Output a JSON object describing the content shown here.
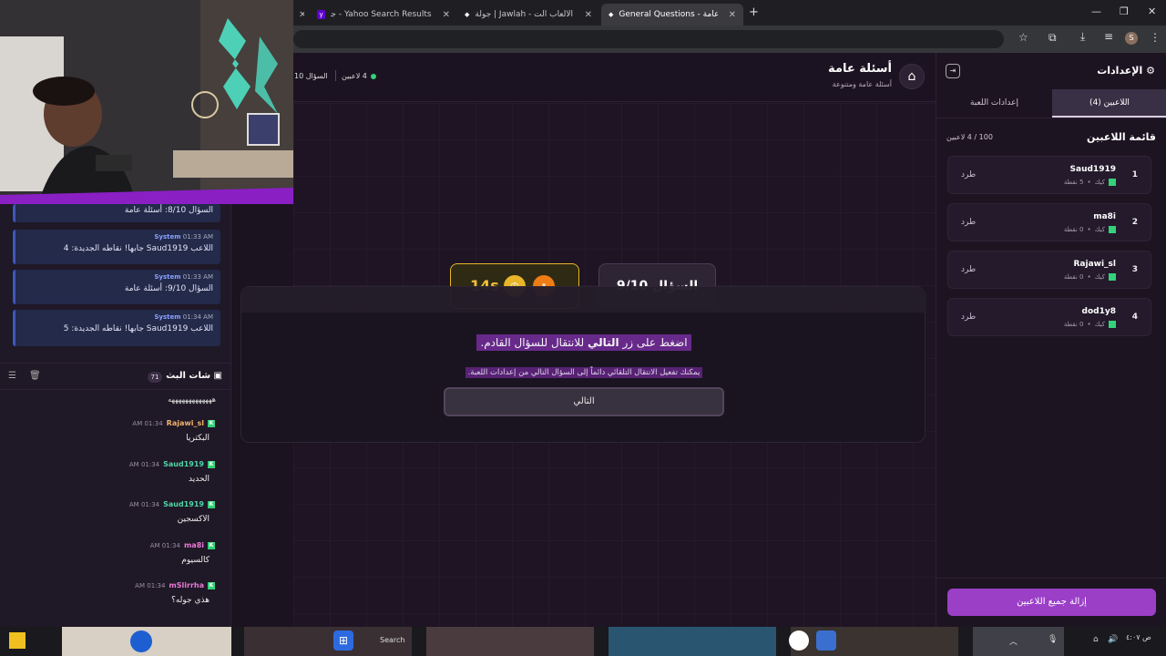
{
  "browser": {
    "tabs": [
      {
        "label": "Yahoo Search Results - جوله شات"
      },
      {
        "label": "جولة | Jawlah - منصة الألعاب الت"
      },
      {
        "label": "General Questions - أسئلة عامة"
      }
    ],
    "new_tab": "+",
    "profile_initial": "S"
  },
  "chat": {
    "system_messages": [
      {
        "sender": "System",
        "time": "01:33 AM",
        "text": "السؤال 8/10: أسئلة عامة"
      },
      {
        "sender": "System",
        "time": "01:33 AM",
        "text": "اللاعب Saud1919 جابها! نقاطه الجديدة: 4"
      },
      {
        "sender": "System",
        "time": "01:33 AM",
        "text": "السؤال 9/10: أسئلة عامة"
      },
      {
        "sender": "System",
        "time": "01:34 AM",
        "text": "اللاعب Saud1919 جابها! نقاطه الجديدة: 5"
      }
    ],
    "header": {
      "title": "شات البث",
      "count": "71"
    },
    "top_text": "هههههههههههههه",
    "messages": [
      {
        "user": "Rajawi_sl",
        "time": "01:34 AM",
        "text": "البكتريا",
        "color": "#f0b36b"
      },
      {
        "user": "Saud1919",
        "time": "01:34 AM",
        "text": "الحديد",
        "color": "#4fd6a5"
      },
      {
        "user": "Saud1919",
        "time": "01:34 AM",
        "text": "الاكسجين",
        "color": "#4fd6a5"
      },
      {
        "user": "ma8i",
        "time": "01:34 AM",
        "text": "كالسيوم",
        "color": "#e879d6"
      },
      {
        "user": "mSlirrha",
        "time": "01:34 AM",
        "text": "هذي جوله؟",
        "color": "#e879d6"
      }
    ]
  },
  "game": {
    "title": "أسئلة عامة",
    "subtitle": "أسئلة عامة ومتنوعة",
    "players_online": "4 لاعبين",
    "question_short": "السؤال 10",
    "question_counter": "السؤال 9/10",
    "timer": "14s",
    "instruction_prefix": "اضغط على زر ",
    "instruction_bold": "التالي",
    "instruction_suffix": " للانتقال للسؤال القادم.",
    "hint": "يمكنك تفعيل الانتقال التلقائي دائماً إلى السؤال التالي من إعدادات اللعبة.",
    "next_button": "التالي"
  },
  "settings": {
    "title": "الإعدادات",
    "tabs": [
      {
        "label": "اللاعبين (4)",
        "active": true
      },
      {
        "label": "إعدادات اللعبة",
        "active": false
      }
    ],
    "list_title": "قائمة اللاعبين",
    "capacity": "100 / 4 لاعبين",
    "players": [
      {
        "rank": "1",
        "name": "Saud1919",
        "platform": "كيك",
        "points": "5 نقطة",
        "kick_label": "طرد"
      },
      {
        "rank": "2",
        "name": "ma8i",
        "platform": "كيك",
        "points": "0 نقطة",
        "kick_label": "طرد"
      },
      {
        "rank": "3",
        "name": "Rajawi_sl",
        "platform": "كيك",
        "points": "0 نقطة",
        "kick_label": "طرد"
      },
      {
        "rank": "4",
        "name": "dod1y8",
        "platform": "كيك",
        "points": "0 نقطة",
        "kick_label": "طرد"
      }
    ],
    "remove_all": "إزالة جميع اللاعبين"
  },
  "taskbar": {
    "search_label": "Search",
    "clock": "ص ٤:٠٧"
  },
  "colors": {
    "accent_purple": "#9b3fc7",
    "timer_gold": "#e8b628",
    "timer_orange": "#ee7c14",
    "kick_green": "#33d17a"
  }
}
